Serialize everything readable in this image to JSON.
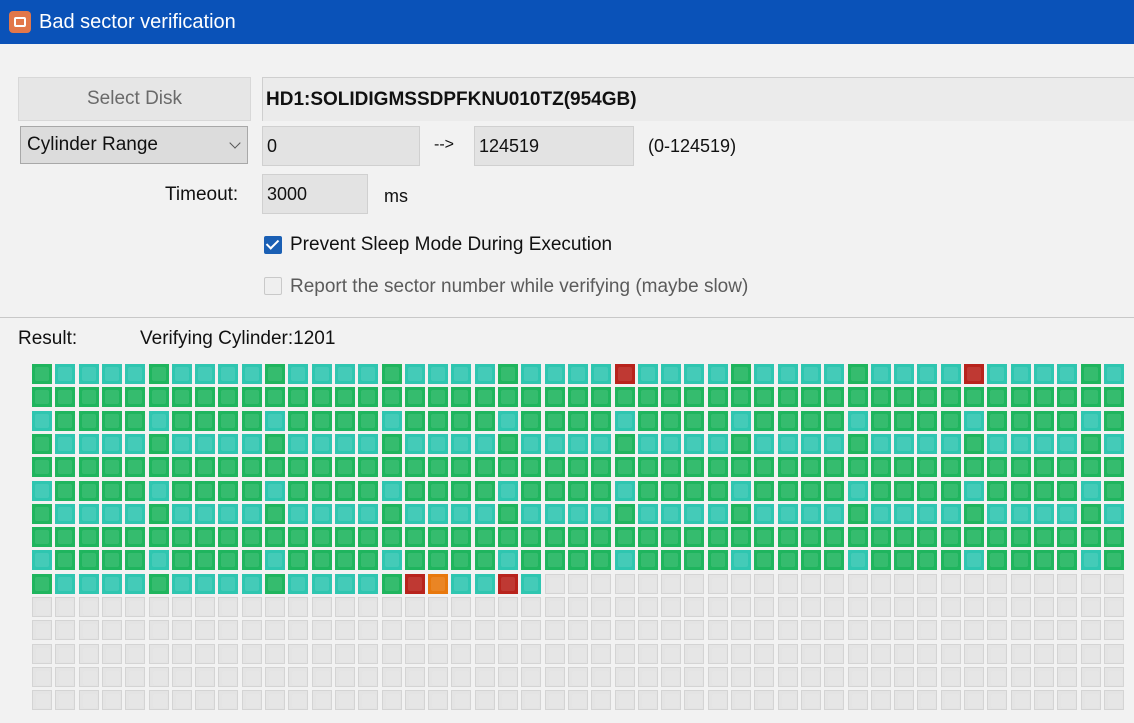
{
  "window": {
    "title": "Bad sector verification",
    "icon": "app-icon"
  },
  "disk": {
    "select_label": "Select Disk",
    "value": "HD1:SOLIDIGMSSDPFKNU010TZ(954GB)"
  },
  "range": {
    "mode": "Cylinder Range",
    "start": "0",
    "arrow": "-->",
    "end": "124519",
    "hint": "(0-124519)"
  },
  "timeout": {
    "label": "Timeout:",
    "value": "3000",
    "unit": "ms"
  },
  "options": {
    "prevent_sleep": {
      "label": "Prevent Sleep Mode During Execution",
      "checked": true
    },
    "report_sector": {
      "label": "Report the sector number while verifying (maybe slow)",
      "checked": false
    }
  },
  "result": {
    "label": "Result:",
    "status": "Verifying Cylinder:1201"
  },
  "block_grid": {
    "cols": 47,
    "rows": 15,
    "colors": {
      "green": "#1fb55e",
      "teal": "#2fc6b0",
      "red": "#b8231c",
      "orange": "#e8780c",
      "empty": "#e4e4e4"
    },
    "scanned_full_rows": 9,
    "last_row_scanned_count": 22,
    "red_blocks": [
      [
        0,
        25
      ],
      [
        0,
        40
      ],
      [
        9,
        16
      ],
      [
        9,
        20
      ]
    ],
    "orange_blocks": [
      [
        9,
        17
      ]
    ]
  }
}
